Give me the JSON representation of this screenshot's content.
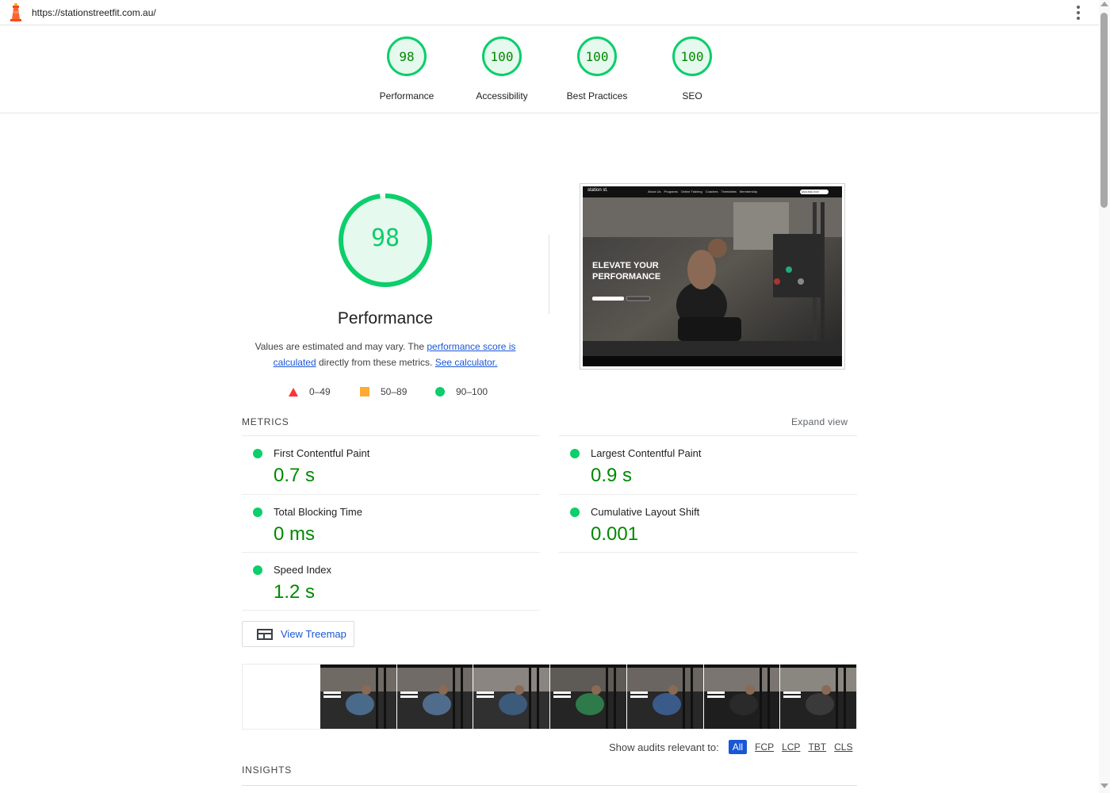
{
  "url_bar": {
    "url": "https://stationstreetfit.com.au/"
  },
  "summary_gauges": [
    {
      "score": "98",
      "label": "Performance"
    },
    {
      "score": "100",
      "label": "Accessibility"
    },
    {
      "score": "100",
      "label": "Best Practices"
    },
    {
      "score": "100",
      "label": "SEO"
    }
  ],
  "performance": {
    "score": "98",
    "score_fraction": 0.98,
    "title": "Performance",
    "desc_pre": "Values are estimated and may vary. The ",
    "desc_link1": "performance score is calculated",
    "desc_mid": " directly from these metrics. ",
    "desc_link2": "See calculator.",
    "legend": {
      "fail": "0–49",
      "average": "50–89",
      "pass": "90–100"
    }
  },
  "screenshot": {
    "brand": "station st.",
    "nav": [
      "About Us",
      "Programs",
      "Online Training",
      "Coaches",
      "Timetables",
      "Membership"
    ],
    "cta": "ENQUIRE NOW",
    "headline_1": "ELEVATE YOUR",
    "headline_2": "PERFORMANCE"
  },
  "metrics_section": {
    "label": "METRICS",
    "expand": "Expand view",
    "items": [
      {
        "name": "First Contentful Paint",
        "value": "0.7 s"
      },
      {
        "name": "Largest Contentful Paint",
        "value": "0.9 s"
      },
      {
        "name": "Total Blocking Time",
        "value": "0 ms"
      },
      {
        "name": "Cumulative Layout Shift",
        "value": "0.001"
      },
      {
        "name": "Speed Index",
        "value": "1.2 s"
      }
    ]
  },
  "treemap": {
    "label": "View Treemap"
  },
  "filters": {
    "label": "Show audits relevant to:",
    "options": [
      "All",
      "FCP",
      "LCP",
      "TBT",
      "CLS"
    ]
  },
  "insights": {
    "label": "INSIGHTS"
  },
  "colors": {
    "pass": "#0cce6b",
    "pass_text": "#008800",
    "average": "#ffaa33",
    "fail": "#ff3333",
    "link": "#1a57d6"
  }
}
